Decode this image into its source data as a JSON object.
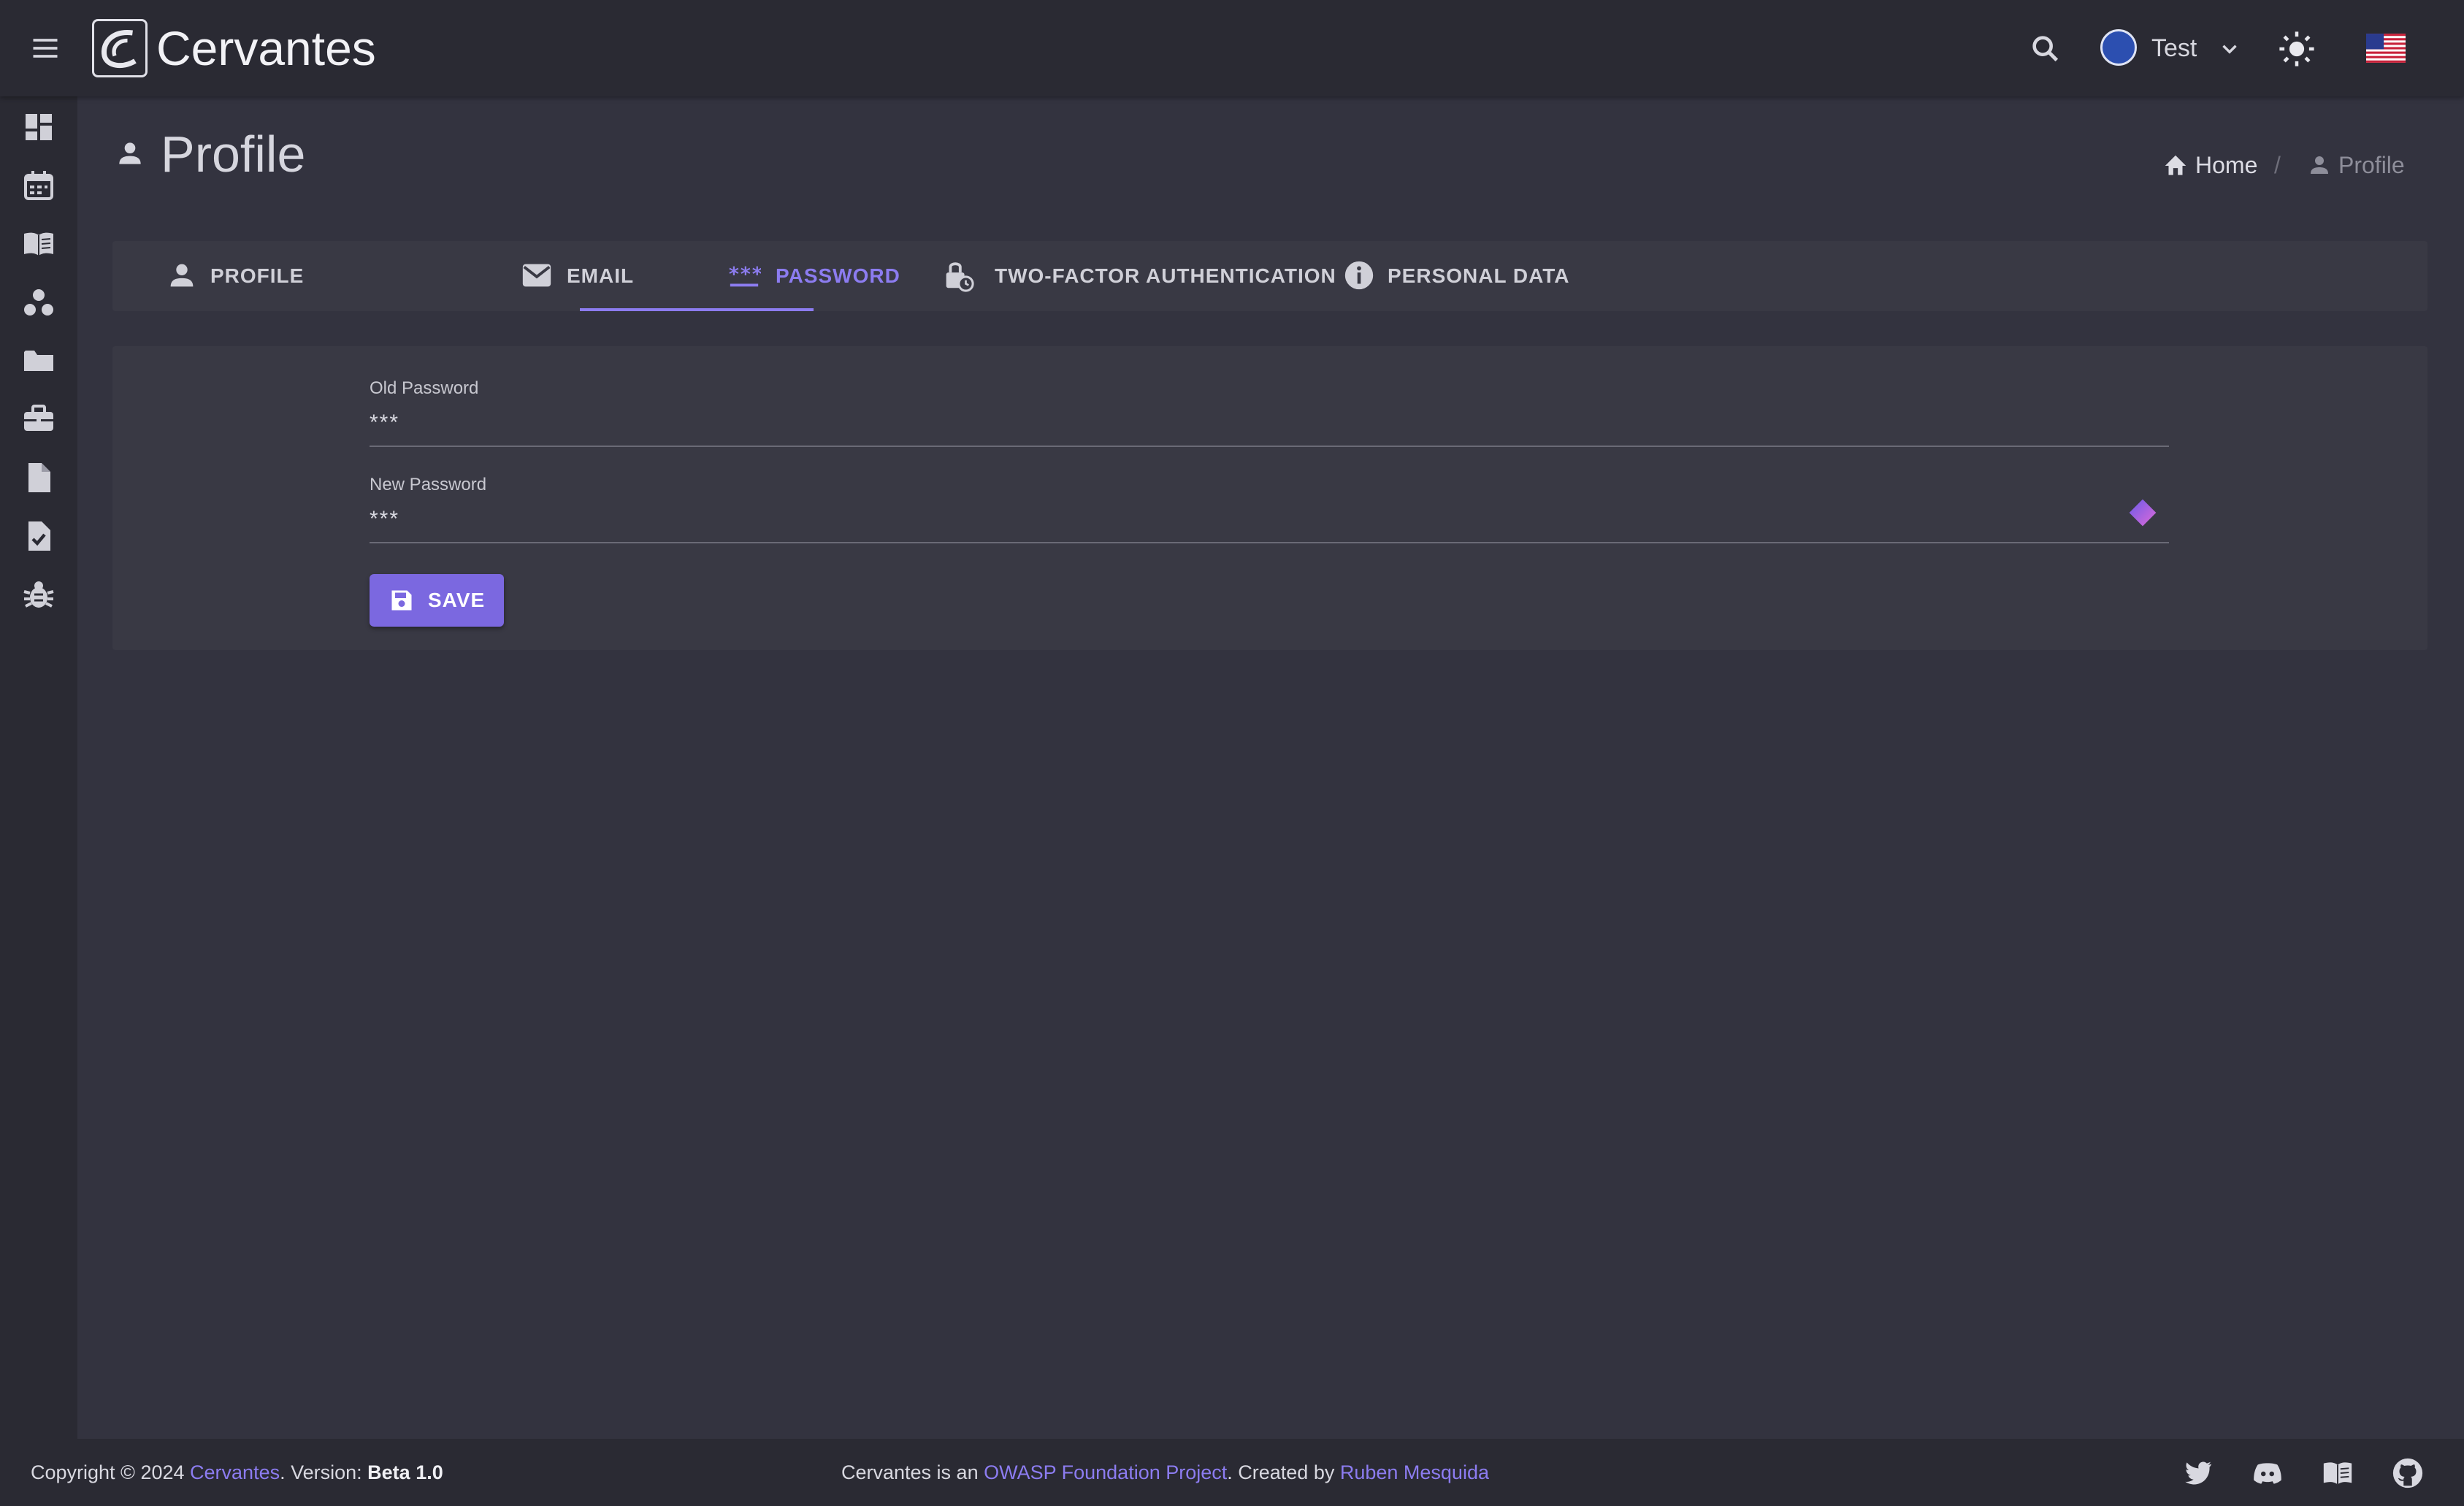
{
  "app": {
    "name": "Cervantes"
  },
  "topbar": {
    "user_name": "Test"
  },
  "sidebar": {
    "items": [
      {
        "name": "dashboard",
        "icon": "dashboard-icon"
      },
      {
        "name": "calendar",
        "icon": "calendar-icon"
      },
      {
        "name": "book",
        "icon": "book-icon"
      },
      {
        "name": "clients",
        "icon": "group-icon"
      },
      {
        "name": "projects",
        "icon": "folder-icon"
      },
      {
        "name": "work",
        "icon": "briefcase-icon"
      },
      {
        "name": "documents",
        "icon": "document-icon"
      },
      {
        "name": "tasks",
        "icon": "task-icon"
      },
      {
        "name": "vulns",
        "icon": "bug-icon"
      }
    ]
  },
  "page": {
    "title": "Profile",
    "breadcrumb": {
      "home": "Home",
      "separator": "/",
      "current": "Profile"
    }
  },
  "tabs": [
    {
      "label": "PROFILE",
      "icon": "person-icon",
      "active": false
    },
    {
      "label": "EMAIL",
      "icon": "mail-icon",
      "active": false
    },
    {
      "label": "PASSWORD",
      "icon": "password-icon",
      "active": true
    },
    {
      "label": "TWO-FACTOR AUTHENTICATION",
      "icon": "lock-icon",
      "active": false
    },
    {
      "label": "PERSONAL DATA",
      "icon": "info-icon",
      "active": false
    }
  ],
  "form": {
    "old_password": {
      "label": "Old Password",
      "value": "***"
    },
    "new_password": {
      "label": "New Password",
      "value": "***"
    },
    "save_label": "SAVE"
  },
  "footer": {
    "copyright_prefix": "Copyright © 2024 ",
    "brand": "Cervantes",
    "version_prefix": ". Version: ",
    "version": "Beta 1.0",
    "project_prefix": "Cervantes is an ",
    "owasp": "OWASP Foundation Project",
    "created_by": ". Created by ",
    "author": "Ruben Mesquida"
  },
  "colors": {
    "accent": "#8c7cf0",
    "button": "#7b68e0",
    "background": "#33333f",
    "bar": "#2a2a33",
    "card": "#393944"
  }
}
